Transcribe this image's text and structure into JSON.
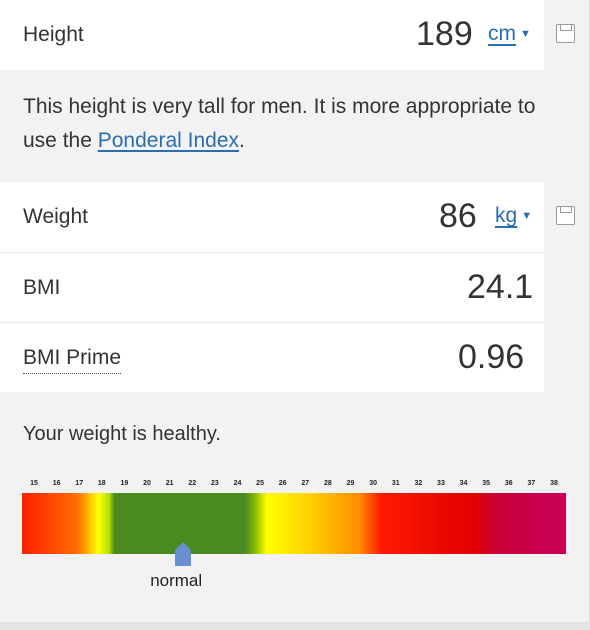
{
  "height": {
    "label": "Height",
    "value": "189",
    "unit": "cm"
  },
  "note": {
    "text_before": "This height is very tall for men. It is more appropriate to use the ",
    "link": "Ponderal Index",
    "text_after": "."
  },
  "weight": {
    "label": "Weight",
    "value": "86",
    "unit": "kg"
  },
  "bmi": {
    "label": "BMI",
    "value": "24.1"
  },
  "bmi_prime": {
    "label": "BMI Prime",
    "value": "0.96"
  },
  "result": {
    "status": "Your weight is healthy."
  },
  "scale": {
    "ticks": [
      "15",
      "16",
      "17",
      "18",
      "19",
      "20",
      "21",
      "22",
      "23",
      "24",
      "25",
      "26",
      "27",
      "28",
      "29",
      "30",
      "31",
      "32",
      "33",
      "34",
      "35",
      "36",
      "37",
      "38"
    ],
    "marker_value": 21.6,
    "marker_label": "normal",
    "marker_color": "#6a8fd0"
  },
  "icons": {
    "save": "save-icon",
    "caret": "caret-down-icon"
  }
}
